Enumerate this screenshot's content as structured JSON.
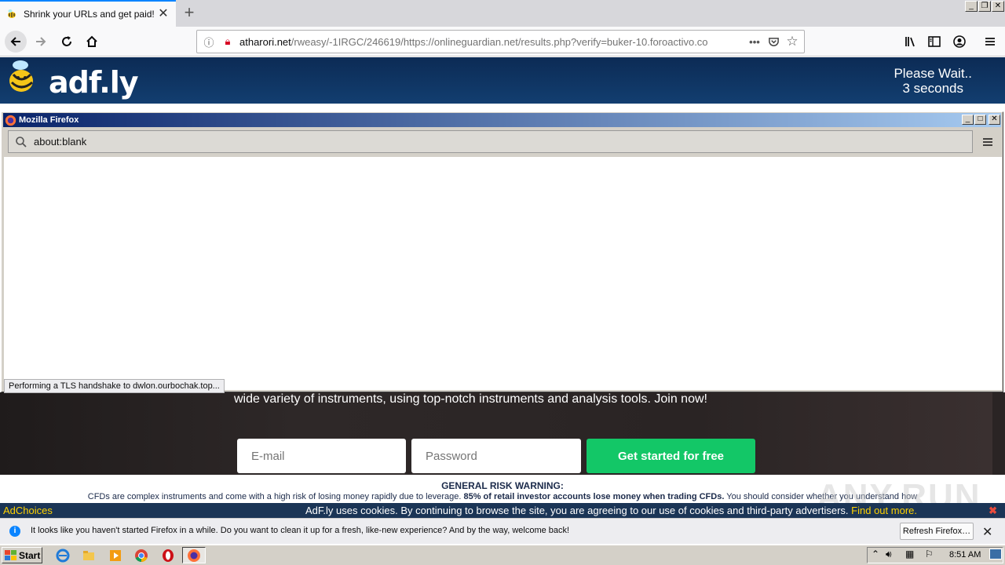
{
  "browser": {
    "tab": {
      "title": "Shrink your URLs and get paid!"
    },
    "url": {
      "host": "atharori.net",
      "path": "/rweasy/-1IRGC/246619/https://onlineguardian.net/results.php?verify=buker-10.foroactivo.co"
    }
  },
  "adfly": {
    "logo_text": "adf.ly",
    "wait_line1": "Please Wait..",
    "wait_line2": "3 seconds"
  },
  "popup": {
    "title": "Mozilla Firefox",
    "url": "about:blank",
    "status": "Performing a TLS handshake to dwlon.ourbochak.top..."
  },
  "page": {
    "hero_text": "wide variety of instruments, using top-notch instruments and analysis tools. Join now!",
    "email_placeholder": "E-mail",
    "password_placeholder": "Password",
    "cta_label": "Get started for free",
    "risk_title": "GENERAL RISK WARNING:",
    "risk_body_pre": "CFDs are complex instruments and come with a high risk of losing money rapidly due to leverage. ",
    "risk_body_bold": "85% of retail investor accounts lose money when trading CFDs.",
    "risk_body_post": " You should consider whether you understand how"
  },
  "cookiebar": {
    "adchoices": "AdChoices",
    "text": "AdF.ly uses cookies. By continuing to browse the site, you are agreeing to our use of cookies and third-party advertisers.",
    "link": "Find out more.",
    "close": "✖"
  },
  "watermark": "ANY.RUN",
  "notification": {
    "text": "It looks like you haven't started Firefox in a while. Do you want to clean it up for a fresh, like-new experience? And by the way, welcome back!",
    "button": "Refresh Firefox…"
  },
  "taskbar": {
    "start": "Start",
    "clock": "8:51 AM"
  },
  "colors": {
    "adfly_blue": "#123e70",
    "cta_green": "#13c767",
    "cookie_link": "#ffd200",
    "titlebar": "#0a246a"
  }
}
